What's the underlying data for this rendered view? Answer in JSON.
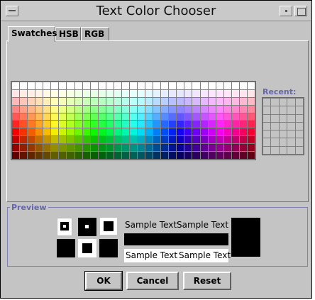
{
  "window": {
    "title": "Text Color Chooser"
  },
  "tabs": [
    {
      "label": "Swatches",
      "selected": true
    },
    {
      "label": "HSB",
      "selected": false
    },
    {
      "label": "RGB",
      "selected": false
    }
  ],
  "swatches": {
    "columns": 31,
    "rows": 10
  },
  "recent": {
    "label": "Recent:",
    "columns": 5,
    "rows": 7,
    "color": "#c4c4c4"
  },
  "preview": {
    "label": "Preview",
    "samples": [
      "Sample Text",
      "Sample Text",
      "Sample Text",
      "Sample Text"
    ]
  },
  "buttons": {
    "ok": "OK",
    "cancel": "Cancel",
    "reset": "Reset"
  },
  "colors": {
    "window_bg": "#c4c4c4",
    "group_label": "#6666aa"
  }
}
